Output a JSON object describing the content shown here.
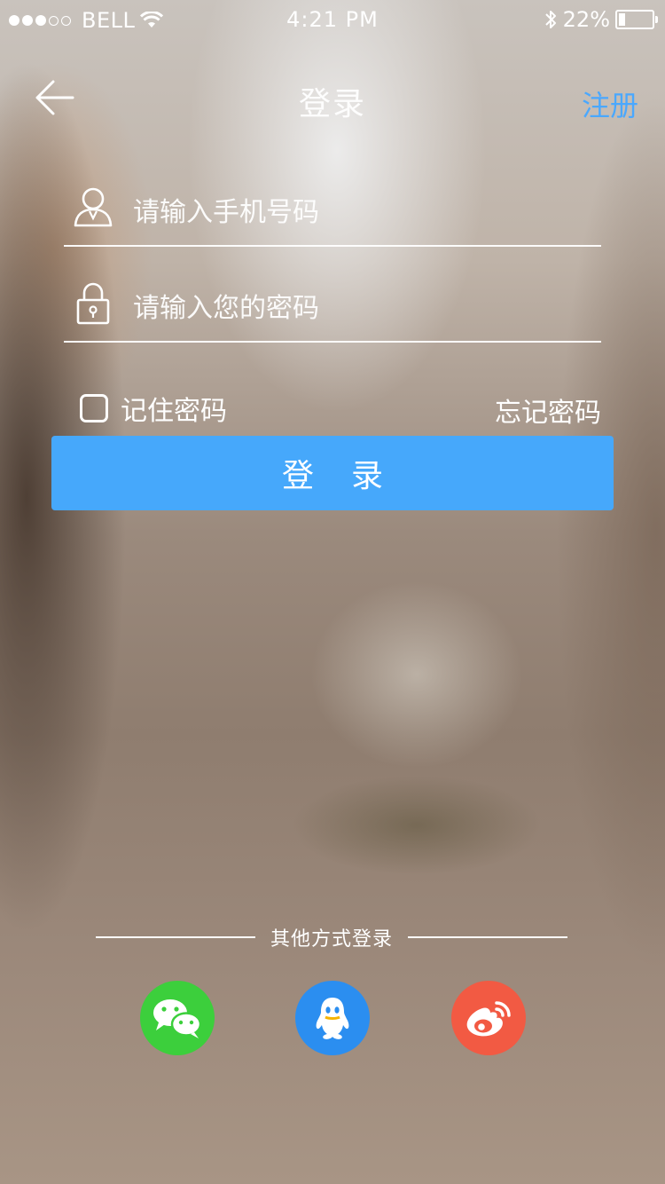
{
  "status_bar": {
    "carrier": "BELL",
    "time": "4:21 PM",
    "battery_text": "22%",
    "battery_level": 0.22,
    "signal_bars_total": 5,
    "signal_bars_filled": 3
  },
  "nav": {
    "title": "登录",
    "register_label": "注册",
    "back_icon": "arrow-left-icon"
  },
  "form": {
    "phone_placeholder": "请输入手机号码",
    "password_placeholder": "请输入您的密码",
    "remember_label": "记住密码",
    "forgot_label": "忘记密码",
    "login_button_label": "登录"
  },
  "other_login": {
    "label": "其他方式登录",
    "providers": [
      {
        "name": "wechat",
        "color": "#3ccf3c"
      },
      {
        "name": "qq",
        "color": "#2b8ef0"
      },
      {
        "name": "weibo",
        "color": "#f25a43"
      }
    ]
  },
  "colors": {
    "accent": "#46a8fb",
    "register_link": "#4aa8ff"
  }
}
